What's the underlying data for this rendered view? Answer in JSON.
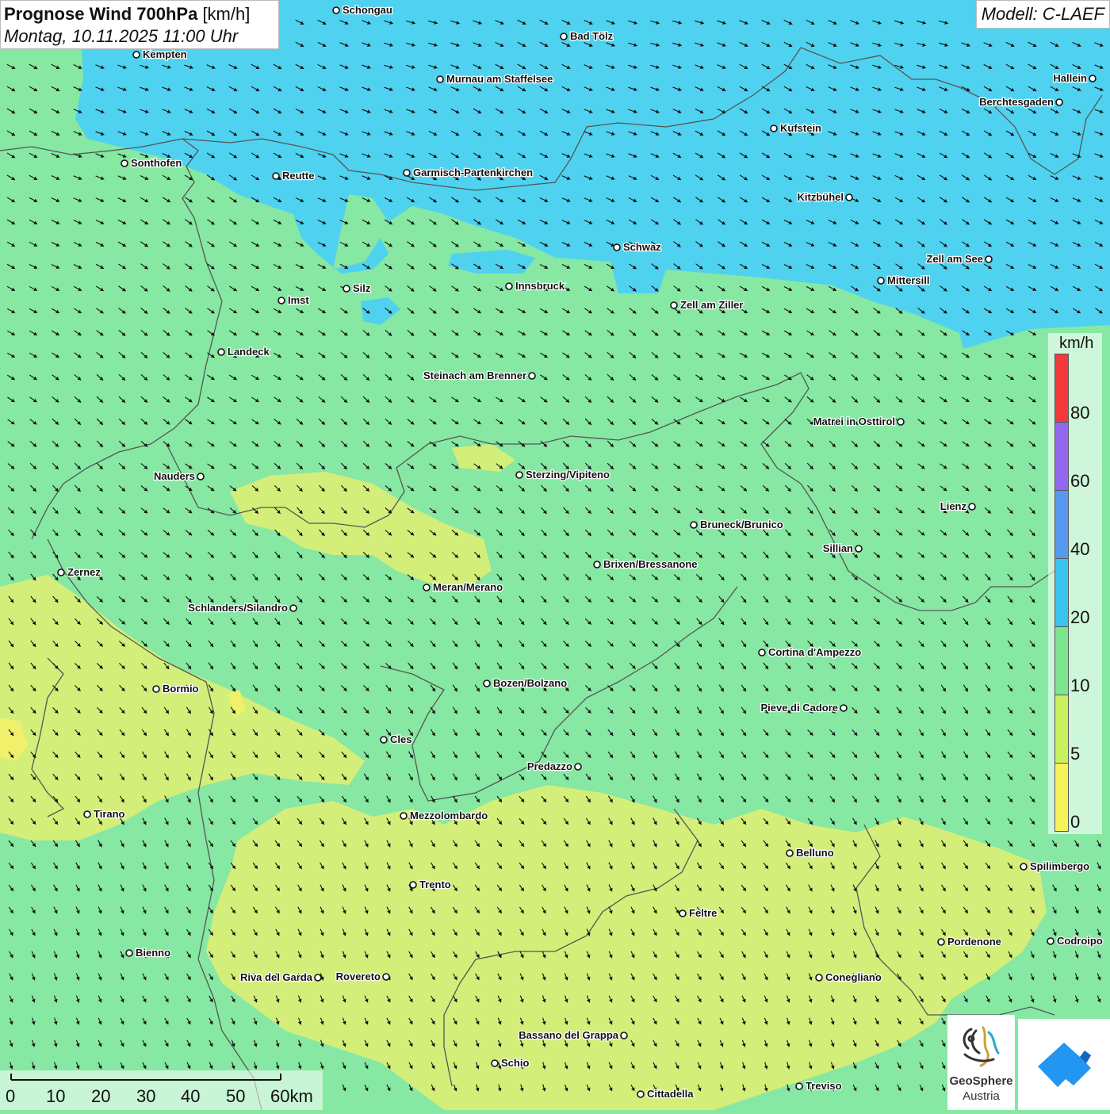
{
  "header": {
    "title_bold": "Prognose Wind 700hPa",
    "title_unit": "[km/h]",
    "datetime": "Montag, 10.11.2025 11:00 Uhr",
    "model": "Modell: C-LAEF"
  },
  "legend": {
    "unit": "km/h",
    "levels": [
      {
        "label": "80",
        "color": "#f23a3a"
      },
      {
        "label": "60",
        "color": "#9467f0"
      },
      {
        "label": "40",
        "color": "#5599f0"
      },
      {
        "label": "20",
        "color": "#3bc3f0"
      },
      {
        "label": "10",
        "color": "#7ee48e"
      },
      {
        "label": "5",
        "color": "#c9f05e"
      },
      {
        "label": "0",
        "color": "#f6f25a"
      }
    ]
  },
  "scalebar": {
    "labels": [
      "0",
      "10",
      "20",
      "30",
      "40",
      "50",
      "60km"
    ]
  },
  "logo": {
    "line1": "GeoSphere",
    "line2": "Austria"
  },
  "colors": {
    "fast_wind_area": "#4fd2f0",
    "medium_wind_area": "#88e89c",
    "slow_wind_area": "#d4ee7a",
    "arrow": "#111111",
    "border": "#555555"
  },
  "cities": [
    {
      "name": "Schongau"
    },
    {
      "name": "Bad Tölz"
    },
    {
      "name": "Kempten"
    },
    {
      "name": "Murnau am Staffelsee"
    },
    {
      "name": "Hallein"
    },
    {
      "name": "Berchtesgaden"
    },
    {
      "name": "Kufstein"
    },
    {
      "name": "Sonthofen"
    },
    {
      "name": "Reutte"
    },
    {
      "name": "Garmisch-Partenkirchen"
    },
    {
      "name": "Kitzbühel"
    },
    {
      "name": "Schwaz"
    },
    {
      "name": "Zell am See"
    },
    {
      "name": "Mittersill"
    },
    {
      "name": "Innsbruck"
    },
    {
      "name": "Silz"
    },
    {
      "name": "Imst"
    },
    {
      "name": "Zell am Ziller"
    },
    {
      "name": "Landeck"
    },
    {
      "name": "Steinach am Brenner"
    },
    {
      "name": "Matrei in Osttirol"
    },
    {
      "name": "Nauders"
    },
    {
      "name": "Sterzing/Vipiteno"
    },
    {
      "name": "Lienz"
    },
    {
      "name": "Bruneck/Brunico"
    },
    {
      "name": "Sillian"
    },
    {
      "name": "Brixen/Bressanone"
    },
    {
      "name": "Zernez"
    },
    {
      "name": "Meran/Merano"
    },
    {
      "name": "Schlanders/Silandro"
    },
    {
      "name": "Cortina d'Ampezzo"
    },
    {
      "name": "Bozen/Bolzano"
    },
    {
      "name": "Bormio"
    },
    {
      "name": "Pieve di Cadore"
    },
    {
      "name": "Cles"
    },
    {
      "name": "Predazzo"
    },
    {
      "name": "Tirano"
    },
    {
      "name": "Mezzolombardo"
    },
    {
      "name": "Belluno"
    },
    {
      "name": "Spilimbergo"
    },
    {
      "name": "Trento"
    },
    {
      "name": "Feltre"
    },
    {
      "name": "Pordenone"
    },
    {
      "name": "Codroipo"
    },
    {
      "name": "Bienno"
    },
    {
      "name": "Riva del Garda"
    },
    {
      "name": "Rovereto"
    },
    {
      "name": "Conegliano"
    },
    {
      "name": "Bassano del Grappa"
    },
    {
      "name": "Schio"
    },
    {
      "name": "Treviso"
    },
    {
      "name": "Cittadella"
    }
  ]
}
